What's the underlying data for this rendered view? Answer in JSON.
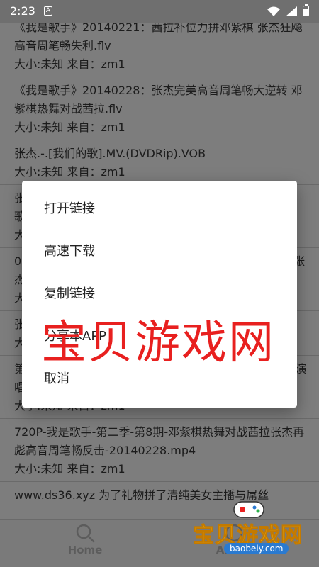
{
  "status_bar": {
    "time": "2:23",
    "notif_icon_label": "A"
  },
  "list": {
    "items": [
      {
        "name": "《我是歌手》20140221：茜拉补位力拼邓紫棋 张杰狂飚高音周笔畅失利.flv",
        "meta": "大小:未知  来自：zm1",
        "partial_top": true
      },
      {
        "name": "《我是歌手》20140228：张杰完美高音周笔畅大逆转 邓紫棋热舞对战茜拉.flv",
        "meta": "大小:未知  来自：zm1"
      },
      {
        "name": "张杰.-.[我们的歌].MV.(DVDRip).VOB",
        "meta": "大小:未知  来自：zm1"
      },
      {
        "name": "张杰.-.[我们的歌].MV.(DVDRip).VOB张杰.-.[我们的歌].mka",
        "meta": "大小:未知  来自：zm1"
      },
      {
        "name": "0228-我是歌手-第二季-第8期-邓紫棋热舞对战茜拉力拼张杰再彪高音周笔畅反击-20140228.mp4",
        "meta": "大小:未知  来自：zm1"
      },
      {
        "name": "张杰.-.[我们的歌].MV.(DVDRip)",
        "meta": "大小:未知  来自：zm1"
      },
      {
        "name": "第一张专辑 张杰巡回演唱会_DVD.rmvb 2011张杰成都演唱会_DVD.rmvb",
        "meta": "大小:未知  来自：zm1"
      },
      {
        "name": "720P-我是歌手-第二季-第8期-邓紫棋热舞对战茜拉张杰再彪高音周笔畅反击-20140228.mp4",
        "meta": "大小:未知  来自：zm1"
      },
      {
        "name": "www.ds36.xyz 为了礼物拼了清纯美女主播与屌丝",
        "meta": ""
      }
    ]
  },
  "dialog": {
    "options": [
      "打开链接",
      "高速下载",
      "复制链接",
      "分享本APP",
      "取消"
    ]
  },
  "bottom_nav": {
    "home_label": "Home",
    "about_label": "About"
  },
  "watermark": {
    "big_text": "宝贝游戏网",
    "logo_text": "宝贝游戏网",
    "logo_url": "baobeiy.com"
  },
  "colors": {
    "scrim": "#7a7a7a",
    "dialog": "#ffffff",
    "watermark_red": "#e8201f",
    "logo_yellow": "#f4c21a"
  }
}
